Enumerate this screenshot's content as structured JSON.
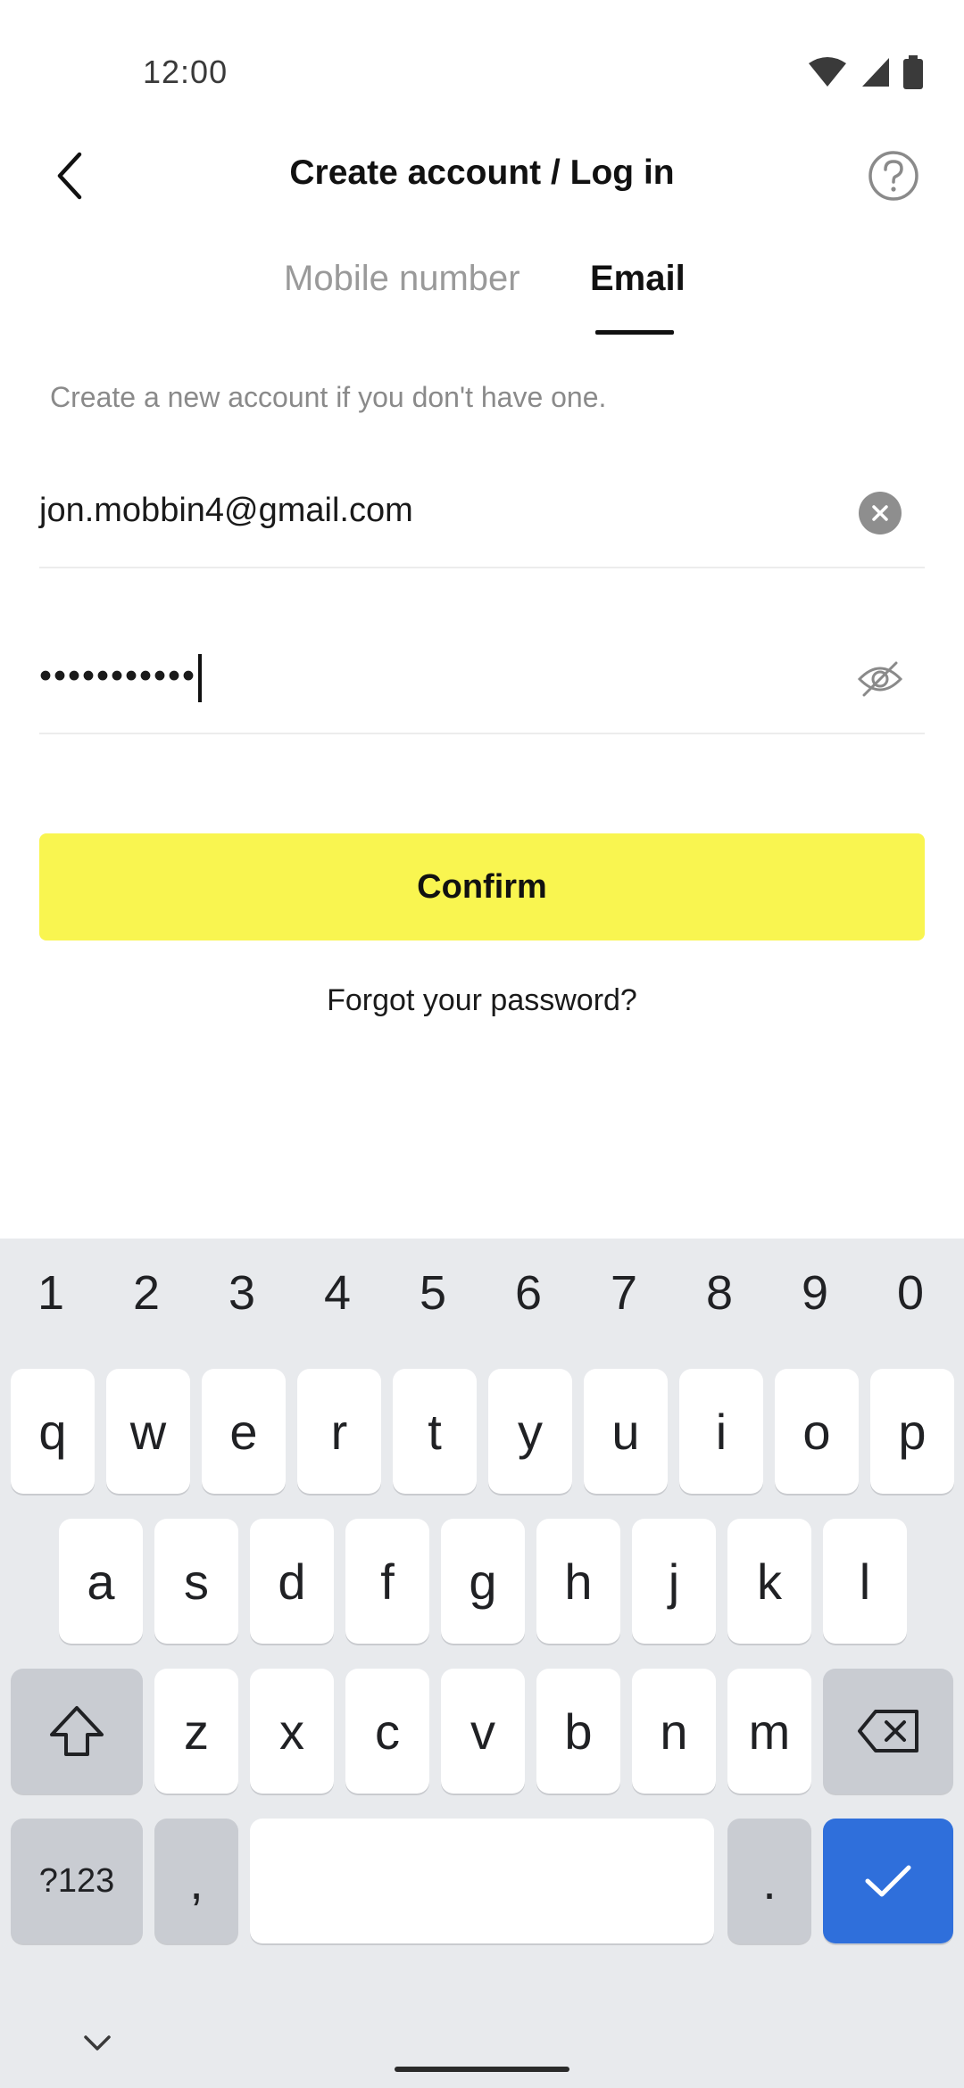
{
  "status_bar": {
    "time": "12:00"
  },
  "header": {
    "title": "Create account / Log in"
  },
  "tabs": [
    {
      "label": "Mobile number",
      "active": false
    },
    {
      "label": "Email",
      "active": true
    }
  ],
  "hint": "Create a new account if you don't have one.",
  "email_field": {
    "value": "jon.mobbin4@gmail.com"
  },
  "password_field": {
    "value": "•••••••••••"
  },
  "confirm_label": "Confirm",
  "forgot_label": "Forgot your password?",
  "colors": {
    "accent": "#f9f550",
    "keyboard_bg": "#e8eaed",
    "action_key": "#2f6fdb"
  },
  "keyboard": {
    "number_row": [
      "1",
      "2",
      "3",
      "4",
      "5",
      "6",
      "7",
      "8",
      "9",
      "0"
    ],
    "row1": [
      "q",
      "w",
      "e",
      "r",
      "t",
      "y",
      "u",
      "i",
      "o",
      "p"
    ],
    "row2": [
      "a",
      "s",
      "d",
      "f",
      "g",
      "h",
      "j",
      "k",
      "l"
    ],
    "row3": [
      "z",
      "x",
      "c",
      "v",
      "b",
      "n",
      "m"
    ],
    "symbols_label": "?123",
    "comma": ",",
    "period": "."
  }
}
